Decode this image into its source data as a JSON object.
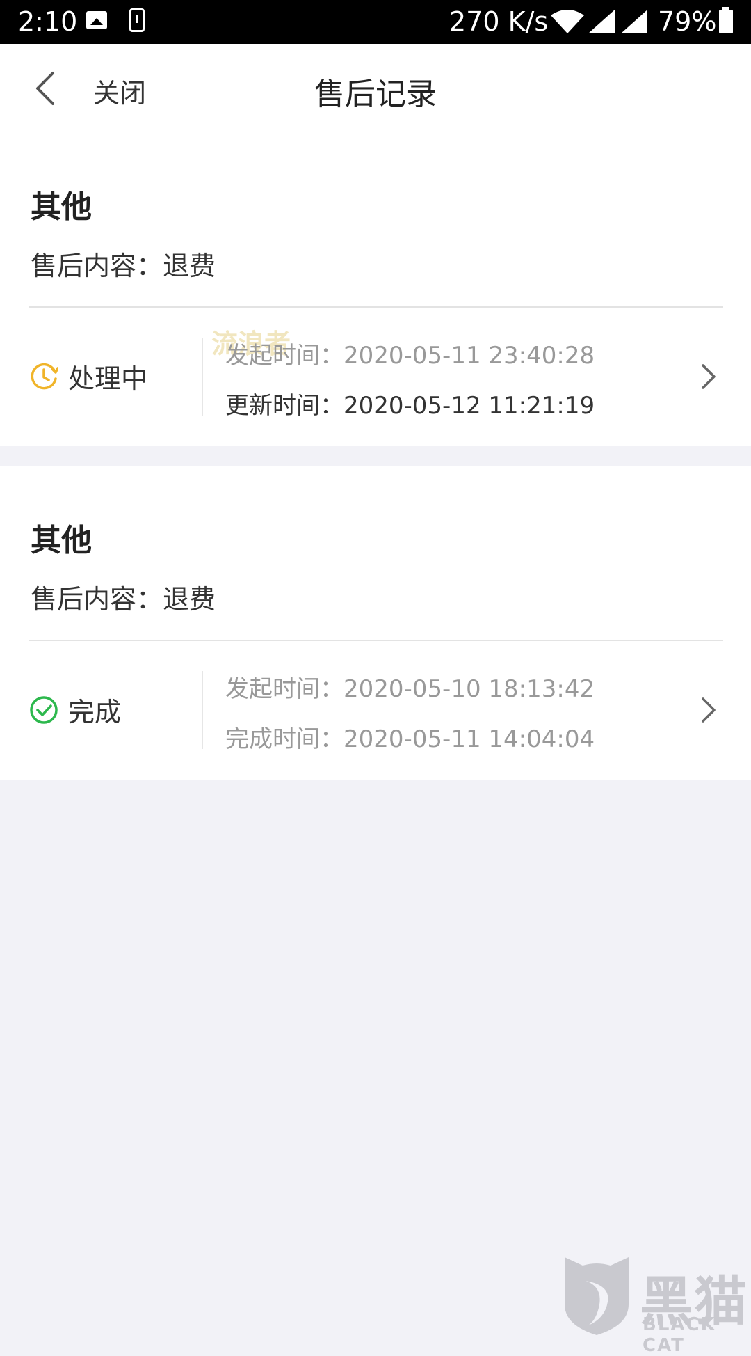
{
  "status_bar": {
    "time": "2:10",
    "network_speed": "270 K/s",
    "battery_percent": "79%",
    "icons": [
      "image-icon",
      "download-icon",
      "wifi-icon",
      "signal-icon",
      "signal-icon",
      "battery-icon"
    ]
  },
  "nav": {
    "back_icon": "chevron-left-icon",
    "close_label": "关闭",
    "title": "售后记录"
  },
  "watermark": {
    "top_text": "流浪者",
    "logo_text": "黑猫",
    "logo_sub": "BLACK CAT"
  },
  "records": [
    {
      "title": "其他",
      "content": "售后内容：退费",
      "status": "处理中",
      "status_icon": "clock-icon",
      "status_color": "#f0b429",
      "start_time": "发起时间：2020-05-11 23:40:28",
      "second_time": "更新时间：2020-05-12 11:21:19"
    },
    {
      "title": "其他",
      "content": "售后内容：退费",
      "status": "完成",
      "status_icon": "check-circle-icon",
      "status_color": "#2db84d",
      "start_time": "发起时间：2020-05-10 18:13:42",
      "second_time": "完成时间：2020-05-11 14:04:04"
    }
  ]
}
